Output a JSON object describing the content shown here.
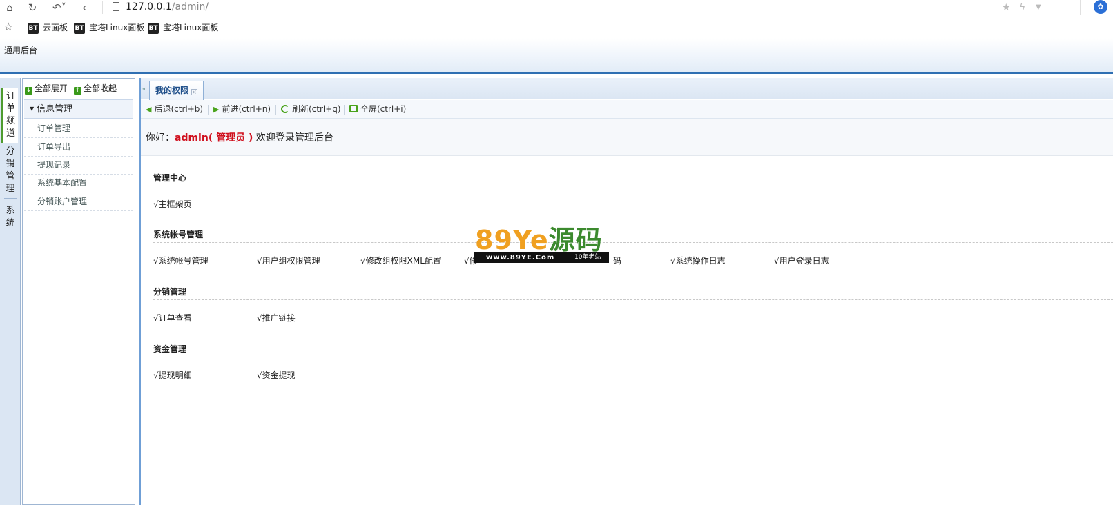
{
  "browser": {
    "url_host": "127.0.0.1",
    "url_path": "/admin/",
    "bookmarks": [
      {
        "badge": "BT",
        "label": "云面板"
      },
      {
        "badge": "BT",
        "label": "宝塔Linux面板"
      },
      {
        "badge": "BT",
        "label": "宝塔Linux面板"
      }
    ]
  },
  "app": {
    "title": "通用后台"
  },
  "channels": [
    {
      "label": "订单频道",
      "active": true
    },
    {
      "label": "分销管理",
      "active": false
    },
    {
      "label": "系统",
      "active": false
    }
  ],
  "menu": {
    "expand_all": "全部展开",
    "collapse_all": "全部收起",
    "group": "信息管理",
    "items": [
      "订单管理",
      "订单导出",
      "提现记录",
      "系统基本配置",
      "分销账户管理"
    ]
  },
  "tabs": {
    "active": "我的权限"
  },
  "toolbar": {
    "back": "后退(ctrl+b)",
    "forward": "前进(ctrl+n)",
    "refresh": "刷新(ctrl+q)",
    "fullscreen": "全屏(ctrl+i)"
  },
  "welcome": {
    "prefix": "你好：",
    "user": "admin( 管理员 )",
    "suffix": " 欢迎登录管理后台"
  },
  "sections": [
    {
      "title": "管理中心",
      "perms": [
        "√主框架页"
      ]
    },
    {
      "title": "系统帐号管理",
      "perms": [
        "√系统帐号管理",
        "√用户组权限管理",
        "√修改组权限XML配置",
        "√修",
        "码",
        "√系统操作日志",
        "√用户登录日志"
      ]
    },
    {
      "title": "分销管理",
      "perms": [
        "√订单查看",
        "√推广链接"
      ]
    },
    {
      "title": "资金管理",
      "perms": [
        "√提现明细",
        "√资金提现"
      ]
    }
  ],
  "watermark": {
    "big_a": "89Ye",
    "big_b": "源码",
    "url": "www.89YE.Com",
    "tag": "10年老站"
  }
}
